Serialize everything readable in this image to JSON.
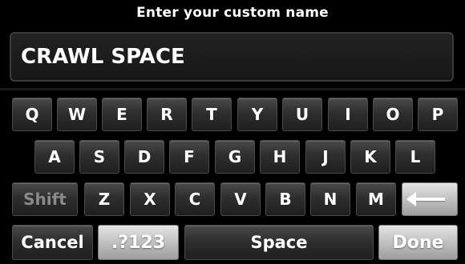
{
  "header": {
    "title": "Enter your custom name"
  },
  "input": {
    "value": "CRAWL SPACE"
  },
  "keyboard": {
    "row1": [
      "Q",
      "W",
      "E",
      "R",
      "T",
      "Y",
      "U",
      "I",
      "O",
      "P"
    ],
    "row2": [
      "A",
      "S",
      "D",
      "F",
      "G",
      "H",
      "J",
      "K",
      "L"
    ],
    "row3_letters": [
      "Z",
      "X",
      "C",
      "V",
      "B",
      "N",
      "M"
    ],
    "shift_label": "Shift",
    "cancel_label": "Cancel",
    "symbols_label": ".?123",
    "space_label": "Space",
    "done_label": "Done",
    "backspace_icon": "backspace-arrow-icon"
  },
  "colors": {
    "background": "#000000",
    "key_dark": "#2e2e2e",
    "key_light": "#bdbdbd",
    "text": "#ffffff",
    "text_dim": "#8a8a8a"
  }
}
